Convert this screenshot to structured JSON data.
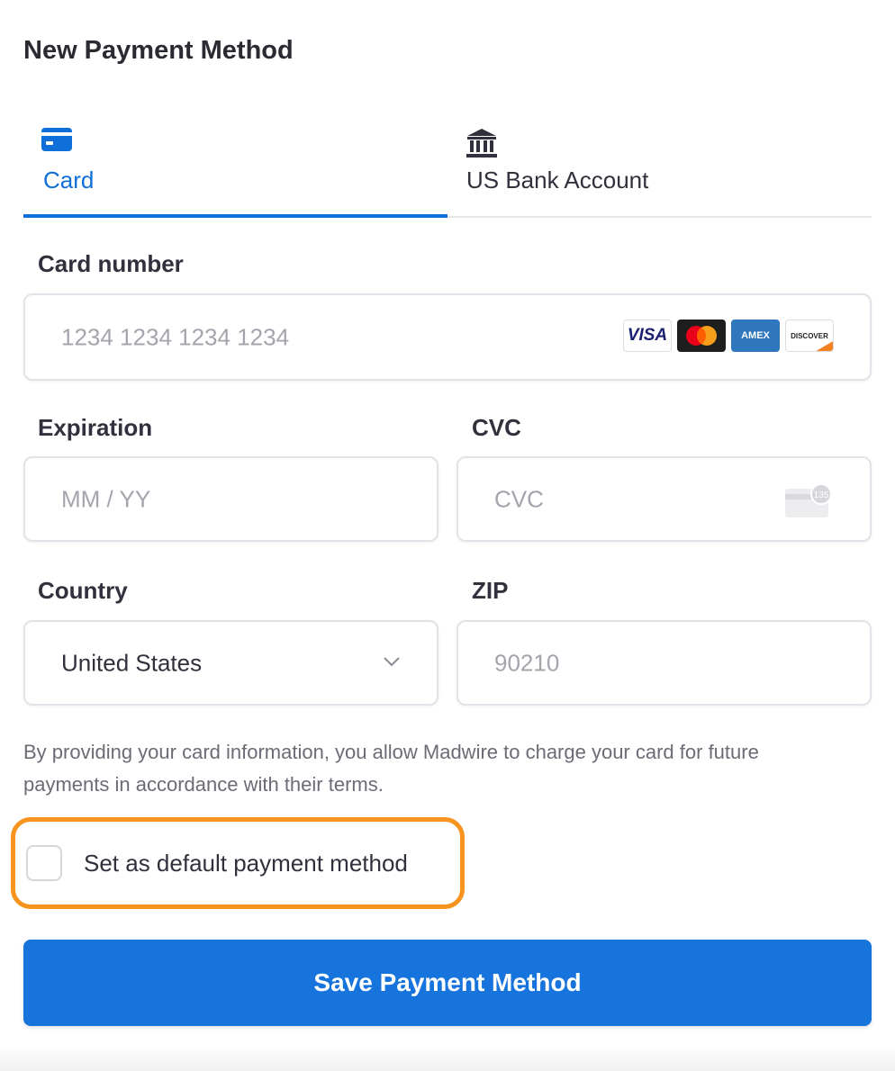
{
  "header": {
    "title": "New Payment Method"
  },
  "tabs": [
    {
      "label": "Card",
      "icon": "credit-card-icon",
      "active": true
    },
    {
      "label": "US Bank Account",
      "icon": "bank-icon",
      "active": false
    }
  ],
  "card_number": {
    "label": "Card number",
    "placeholder": "1234 1234 1234 1234",
    "brands": [
      "VISA",
      "mastercard",
      "AMEX",
      "DISCOVER"
    ]
  },
  "expiration": {
    "label": "Expiration",
    "placeholder": "MM / YY"
  },
  "cvc": {
    "label": "CVC",
    "placeholder": "CVC",
    "icon_text": "135"
  },
  "country": {
    "label": "Country",
    "value": "United States"
  },
  "zip": {
    "label": "ZIP",
    "placeholder": "90210"
  },
  "notice": "By providing your card information, you allow Madwire to charge your card for future payments in accordance with their terms.",
  "default_option": {
    "label": "Set as default payment method",
    "checked": false
  },
  "save_button": {
    "label": "Save Payment Method"
  },
  "colors": {
    "accent": "#0f6fd9",
    "button": "#1774dc",
    "highlight": "#f7941d"
  }
}
